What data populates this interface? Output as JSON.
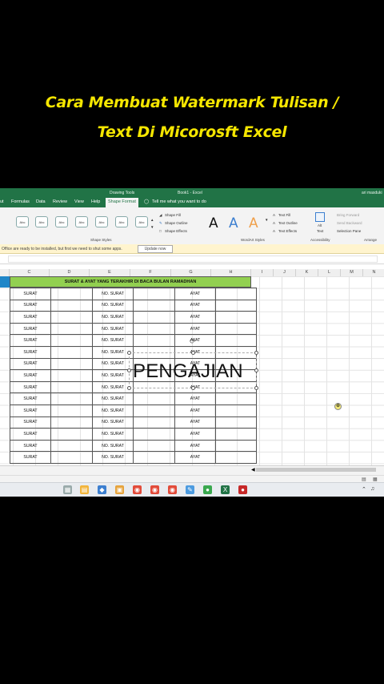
{
  "overlay": {
    "title_line1": "Cara Membuat Watermark Tulisan /",
    "title_line2": "Text Di Micorosft Excel"
  },
  "excel": {
    "context_tab": "Drawing Tools",
    "doc_title": "Book1 - Excel",
    "user": "ari masduki",
    "tabs": [
      "ut",
      "Formulas",
      "Data",
      "Review",
      "View",
      "Help",
      "Shape Format"
    ],
    "active_tab": "Shape Format",
    "tell_me": "Tell me what you want to do",
    "style_thumb_label": "Abc",
    "shape_fill": "Shape Fill",
    "shape_outline": "Shape Outline",
    "shape_effects": "Shape Effects",
    "text_fill": "Text Fill",
    "text_outline": "Text Outline",
    "text_effects": "Text Effects",
    "alt_text_1": "Alt",
    "alt_text_2": "Text",
    "bring_forward": "Bring Forward",
    "send_backward": "Send Backward",
    "selection_pane": "Selection Pane",
    "group_shape_styles": "Shape Styles",
    "group_wordart": "WordArt Styles",
    "group_accessibility": "Accessibility",
    "group_arrange": "Arrange",
    "wordart_letter": "A",
    "notification": "Office are ready to be installed, but first we need to shut some apps.",
    "update_button": "Update now",
    "columns": [
      "C",
      "D",
      "E",
      "F",
      "G",
      "H",
      "I",
      "J",
      "K",
      "L",
      "M",
      "N"
    ],
    "banner": "SURAT & AYAT YANG TERAKHIR DI BACA BULAN RAMADHAN",
    "cell_surat": "SURAT",
    "cell_no_surat": "NO. SURAT",
    "cell_ayat": "AYAT",
    "watermark_text": "PENGAJIAN",
    "accent": "#217346",
    "banner_color": "#92d050"
  }
}
